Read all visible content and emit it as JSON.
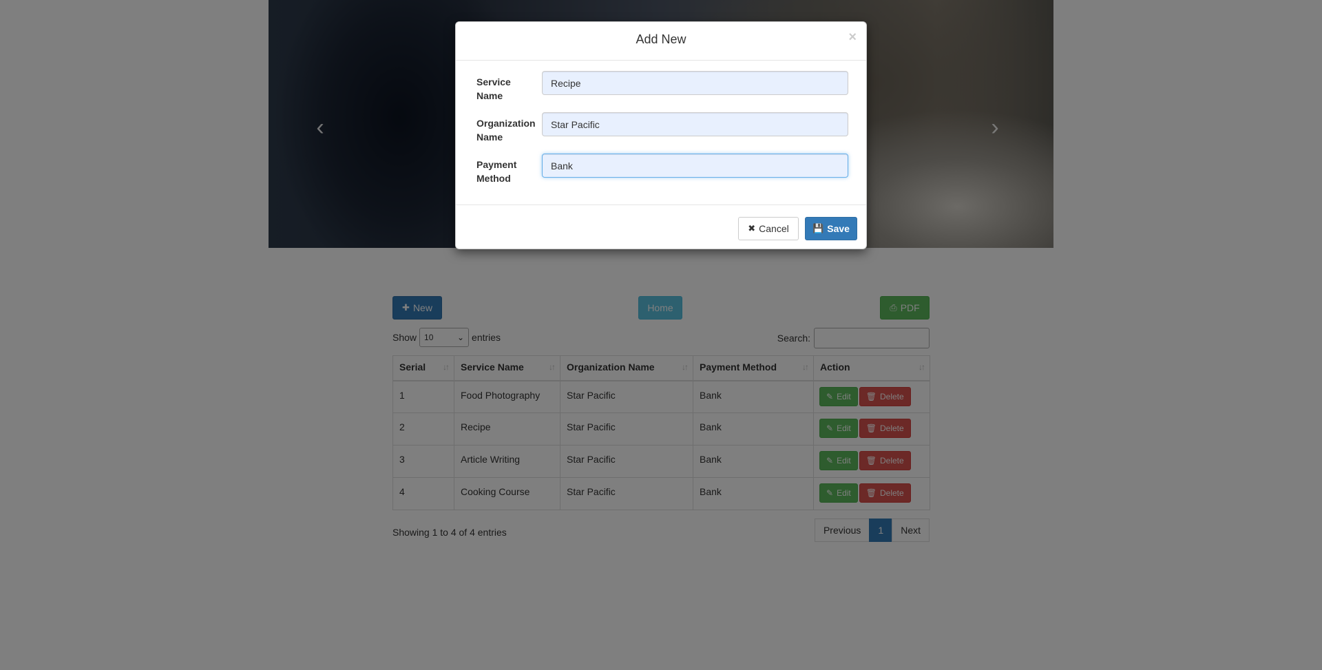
{
  "carousel": {
    "prev_icon": "chevron-left-icon",
    "next_icon": "chevron-right-icon"
  },
  "toolbar": {
    "new_label": "New",
    "home_label": "Home",
    "pdf_label": "PDF"
  },
  "datatable": {
    "show_label": "Show",
    "entries_label": "entries",
    "page_length": "10",
    "search_label": "Search:",
    "columns": [
      "Serial",
      "Service Name",
      "Organization Name",
      "Payment Method",
      "Action"
    ],
    "rows": [
      {
        "serial": "1",
        "service": "Food Photography",
        "organization": "Star Pacific",
        "payment": "Bank"
      },
      {
        "serial": "2",
        "service": "Recipe",
        "organization": "Star Pacific",
        "payment": "Bank"
      },
      {
        "serial": "3",
        "service": "Article Writing",
        "organization": "Star Pacific",
        "payment": "Bank"
      },
      {
        "serial": "4",
        "service": "Cooking Course",
        "organization": "Star Pacific",
        "payment": "Bank"
      }
    ],
    "edit_label": "Edit",
    "delete_label": "Delete",
    "info": "Showing 1 to 4 of 4 entries",
    "pagination": {
      "previous": "Previous",
      "current": "1",
      "next": "Next"
    }
  },
  "modal": {
    "title": "Add New",
    "close": "×",
    "fields": {
      "service_name": {
        "label": "Service Name",
        "value": "Recipe"
      },
      "organization_name": {
        "label": "Organization Name",
        "value": "Star Pacific"
      },
      "payment_method": {
        "label": "Payment Method",
        "value": "Bank"
      }
    },
    "cancel_label": "Cancel",
    "save_label": "Save"
  },
  "colors": {
    "primary": "#337ab7",
    "success": "#5cb85c",
    "danger": "#d9534f",
    "info": "#5bc0de",
    "backdrop": "rgba(0,0,0,0.5)"
  }
}
